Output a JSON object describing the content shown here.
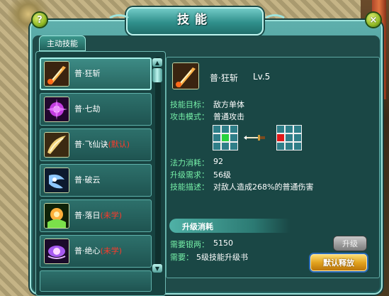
{
  "window": {
    "title": "技能",
    "help_label": "?",
    "close_label": "×"
  },
  "tab": {
    "label": "主动技能"
  },
  "skills": [
    {
      "name": "普·狂斩",
      "tag": "",
      "icon": "flaming-blade-icon"
    },
    {
      "name": "普·七劫",
      "tag": "",
      "icon": "purple-burst-icon"
    },
    {
      "name": "普·飞仙诀",
      "tag": "(默认)",
      "icon": "golden-wings-icon"
    },
    {
      "name": "普·破云",
      "tag": "",
      "icon": "blue-spirit-icon"
    },
    {
      "name": "普·落日",
      "tag": "(未学)",
      "icon": "green-sun-icon"
    },
    {
      "name": "普·绝心",
      "tag": "(未学)",
      "icon": "purple-lotus-icon"
    }
  ],
  "scroll": {
    "up": "▲",
    "down": "▼"
  },
  "detail": {
    "name": "普·狂斩",
    "level": "Lv.5",
    "target_label": "技能目标：",
    "target_value": "敌方单体",
    "mode_label": "攻击模式：",
    "mode_value": "普通攻击",
    "mana_label": "法力消耗：",
    "mana_value": "92",
    "req_label": "升级需求：",
    "req_value": "56级",
    "desc_label": "技能描述：",
    "desc_value": "对敌人造成268%的普通伤害",
    "upgrade_title": "升级消耗",
    "silver_label": "需要银两：",
    "silver_value": "5150",
    "need_label": "需要：",
    "need_value": "5级技能升级书",
    "upgrade_button": "升级",
    "default_button": "默认释放"
  },
  "colors": {
    "label_green": "#76f0a8",
    "warning_red": "#ff3a2a",
    "grid_green": "#29d23c",
    "grid_red": "#e01818"
  }
}
